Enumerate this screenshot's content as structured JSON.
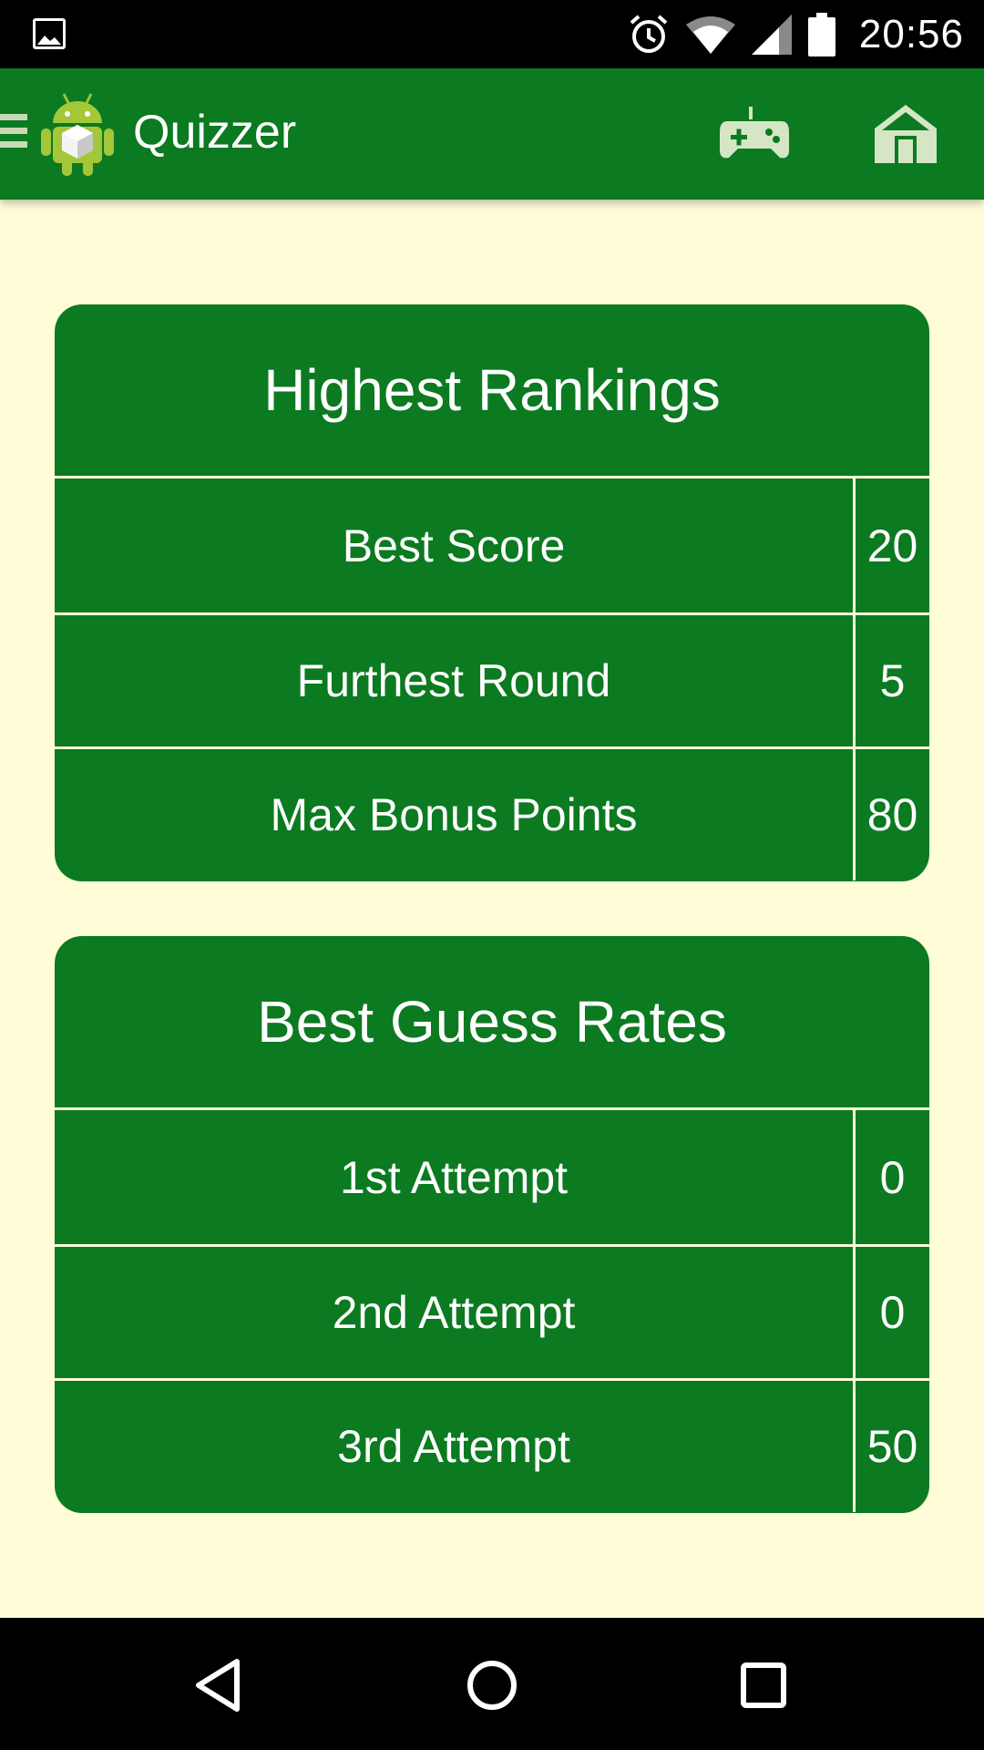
{
  "status_bar": {
    "time": "20:56",
    "icons": [
      "gallery-icon",
      "alarm-icon",
      "wifi-icon",
      "signal-icon",
      "battery-icon"
    ]
  },
  "app_bar": {
    "title": "Quizzer",
    "actions": [
      "game-controller-icon",
      "home-icon"
    ]
  },
  "colors": {
    "app_bar": "#0b7a20",
    "card": "#0b7a20",
    "background": "#fffcd8",
    "text": "#ffffff"
  },
  "highest_rankings": {
    "title": "Highest Rankings",
    "rows": [
      {
        "label": "Best Score",
        "value": "20"
      },
      {
        "label": "Furthest Round",
        "value": "5"
      },
      {
        "label": "Max Bonus Points",
        "value": "80"
      }
    ]
  },
  "best_guess_rates": {
    "title": "Best Guess Rates",
    "rows": [
      {
        "label": "1st Attempt",
        "value": "0"
      },
      {
        "label": "2nd Attempt",
        "value": "0"
      },
      {
        "label": "3rd Attempt",
        "value": "50"
      }
    ]
  },
  "nav_bar": {
    "buttons": [
      "back-icon",
      "home-circle-icon",
      "recents-icon"
    ]
  }
}
